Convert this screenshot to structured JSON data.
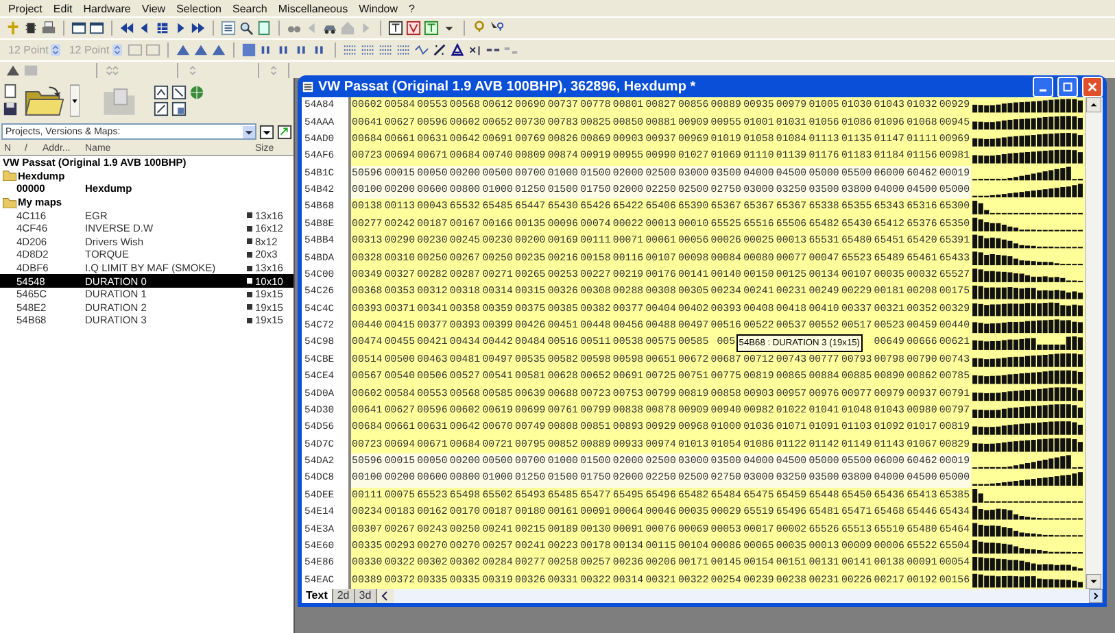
{
  "menu": [
    "Project",
    "Edit",
    "Hardware",
    "View",
    "Selection",
    "Search",
    "Miscellaneous",
    "Window",
    "?"
  ],
  "format_bar": {
    "font_sizes": [
      {
        "value": "12 Point",
        "disabled": true
      },
      {
        "value": "12 Point",
        "disabled": true
      }
    ]
  },
  "project_panel": {
    "selector": {
      "value": "Projects, Versions & Maps:"
    },
    "columns": [
      "N",
      "/",
      "Addr...",
      "Name",
      "Size"
    ],
    "tree": {
      "title": "VW Passat (Original 1.9 AVB 100BHP)",
      "children": [
        {
          "name": "Hexdump",
          "children": [
            {
              "address": "00000",
              "name": "Hexdump",
              "selected": false
            }
          ]
        },
        {
          "name": "My maps",
          "children": [
            {
              "address": "4C116",
              "name": "EGR",
              "size": "13x16",
              "selected": false
            },
            {
              "address": "4CF46",
              "name": "INVERSE D.W",
              "size": "16x12",
              "selected": false
            },
            {
              "address": "4D206",
              "name": "Drivers Wish",
              "size": "8x12",
              "selected": false
            },
            {
              "address": "4D8D2",
              "name": "TORQUE",
              "size": "20x3",
              "selected": false
            },
            {
              "address": "4DBF6",
              "name": "I.Q LIMIT BY MAF (SMOKE)",
              "size": "13x16",
              "selected": false
            },
            {
              "address": "54548",
              "name": "DURATION 0",
              "size": "10x10",
              "selected": true
            },
            {
              "address": "5465C",
              "name": "DURATION 1",
              "size": "19x15",
              "selected": false
            },
            {
              "address": "548E2",
              "name": "DURATION 2",
              "size": "19x15",
              "selected": false
            },
            {
              "address": "54B68",
              "name": "DURATION 3",
              "size": "19x15",
              "selected": false
            }
          ]
        }
      ]
    }
  },
  "window": {
    "title": "VW Passat (Original 1.9 AVB 100BHP), 362896, Hexdump *",
    "rows": [
      {
        "address": "54A84",
        "kind": "map",
        "cells": [
          "00602",
          "00584",
          "00553",
          "00568",
          "00612",
          "00690",
          "00737",
          "00778",
          "00801",
          "00827",
          "00856",
          "00889",
          "00935",
          "00979",
          "01005",
          "01030",
          "01043",
          "01032",
          "00929"
        ]
      },
      {
        "address": "54AAA",
        "kind": "map",
        "cells": [
          "00641",
          "00627",
          "00596",
          "00602",
          "00652",
          "00730",
          "00783",
          "00825",
          "00850",
          "00881",
          "00909",
          "00955",
          "01001",
          "01031",
          "01056",
          "01086",
          "01096",
          "01068",
          "00945"
        ]
      },
      {
        "address": "54AD0",
        "kind": "map",
        "cells": [
          "00684",
          "00661",
          "00631",
          "00642",
          "00691",
          "00769",
          "00826",
          "00869",
          "00903",
          "00937",
          "00969",
          "01019",
          "01058",
          "01084",
          "01113",
          "01135",
          "01147",
          "01111",
          "00969"
        ]
      },
      {
        "address": "54AF6",
        "kind": "map",
        "cells": [
          "00723",
          "00694",
          "00671",
          "00684",
          "00740",
          "00809",
          "00874",
          "00919",
          "00955",
          "00990",
          "01027",
          "01069",
          "01110",
          "01139",
          "01176",
          "01183",
          "01184",
          "01156",
          "00981"
        ]
      },
      {
        "address": "54B1C",
        "kind": "axis",
        "cells": [
          "50596",
          "00015",
          "00050",
          "00200",
          "00500",
          "00700",
          "01000",
          "01500",
          "02000",
          "02500",
          "03000",
          "03500",
          "04000",
          "04500",
          "05000",
          "05500",
          "06000",
          "60462",
          "00019"
        ]
      },
      {
        "address": "54B42",
        "kind": "axis",
        "cells": [
          "00100",
          "00200",
          "00600",
          "00800",
          "01000",
          "01250",
          "01500",
          "01750",
          "02000",
          "02250",
          "02500",
          "02750",
          "03000",
          "03250",
          "03500",
          "03800",
          "04000",
          "04500",
          "05000"
        ]
      },
      {
        "address": "54B68",
        "kind": "map",
        "cells": [
          "00138",
          "00113",
          "00043",
          "65532",
          "65485",
          "65447",
          "65430",
          "65426",
          "65422",
          "65406",
          "65390",
          "65367",
          "65367",
          "65367",
          "65338",
          "65355",
          "65343",
          "65316",
          "65300"
        ]
      },
      {
        "address": "54B8E",
        "kind": "map",
        "cells": [
          "00277",
          "00242",
          "00187",
          "00167",
          "00166",
          "00135",
          "00096",
          "00074",
          "00022",
          "00013",
          "00010",
          "65525",
          "65516",
          "65506",
          "65482",
          "65430",
          "65412",
          "65376",
          "65350"
        ]
      },
      {
        "address": "54BB4",
        "kind": "map",
        "cells": [
          "00313",
          "00290",
          "00230",
          "00245",
          "00230",
          "00200",
          "00169",
          "00111",
          "00071",
          "00061",
          "00056",
          "00026",
          "00025",
          "00013",
          "65531",
          "65480",
          "65451",
          "65420",
          "65391"
        ]
      },
      {
        "address": "54BDA",
        "kind": "map",
        "cells": [
          "00328",
          "00310",
          "00250",
          "00267",
          "00250",
          "00235",
          "00216",
          "00158",
          "00116",
          "00107",
          "00098",
          "00084",
          "00080",
          "00077",
          "00047",
          "65523",
          "65489",
          "65461",
          "65433"
        ]
      },
      {
        "address": "54C00",
        "kind": "map",
        "cells": [
          "00349",
          "00327",
          "00282",
          "00287",
          "00271",
          "00265",
          "00253",
          "00227",
          "00219",
          "00176",
          "00141",
          "00140",
          "00150",
          "00125",
          "00134",
          "00107",
          "00035",
          "00032",
          "65527"
        ]
      },
      {
        "address": "54C26",
        "kind": "map",
        "cells": [
          "00368",
          "00353",
          "00312",
          "00318",
          "00314",
          "00315",
          "00326",
          "00308",
          "00288",
          "00308",
          "00305",
          "00234",
          "00241",
          "00231",
          "00249",
          "00229",
          "00181",
          "00208",
          "00175"
        ]
      },
      {
        "address": "54C4C",
        "kind": "map",
        "cells": [
          "00393",
          "00371",
          "00341",
          "00358",
          "00359",
          "00375",
          "00385",
          "00382",
          "00377",
          "00404",
          "00402",
          "00393",
          "00408",
          "00418",
          "00410",
          "00337",
          "00321",
          "00352",
          "00329"
        ]
      },
      {
        "address": "54C72",
        "kind": "map",
        "cells": [
          "00440",
          "00415",
          "00377",
          "00393",
          "00399",
          "00426",
          "00451",
          "00448",
          "00456",
          "00488",
          "00497",
          "00516",
          "00522",
          "00537",
          "00552",
          "00517",
          "00523",
          "00459",
          "00440"
        ]
      },
      {
        "address": "54C98",
        "kind": "map",
        "tooltip": "54B68 : DURATION 3 (19x15)",
        "cells": [
          "00474",
          "00455",
          "00421",
          "00434",
          "00442",
          "00484",
          "00516",
          "00511",
          "00538",
          "00575",
          "00585",
          "005",
          null,
          null,
          null,
          null,
          "00649",
          "00666",
          "00621"
        ]
      },
      {
        "address": "54CBE",
        "kind": "map",
        "cells": [
          "00514",
          "00500",
          "00463",
          "00481",
          "00497",
          "00535",
          "00582",
          "00598",
          "00598",
          "00651",
          "00672",
          "00687",
          "00712",
          "00743",
          "00777",
          "00793",
          "00798",
          "00790",
          "00743"
        ]
      },
      {
        "address": "54CE4",
        "kind": "map",
        "cells": [
          "00567",
          "00540",
          "00506",
          "00527",
          "00541",
          "00581",
          "00628",
          "00652",
          "00691",
          "00725",
          "00751",
          "00775",
          "00819",
          "00865",
          "00884",
          "00885",
          "00890",
          "00862",
          "00785"
        ]
      },
      {
        "address": "54D0A",
        "kind": "map",
        "cells": [
          "00602",
          "00584",
          "00553",
          "00568",
          "00585",
          "00639",
          "00688",
          "00723",
          "00753",
          "00799",
          "00819",
          "00858",
          "00903",
          "00957",
          "00976",
          "00977",
          "00979",
          "00937",
          "00791"
        ]
      },
      {
        "address": "54D30",
        "kind": "map",
        "cells": [
          "00641",
          "00627",
          "00596",
          "00602",
          "00619",
          "00699",
          "00761",
          "00799",
          "00838",
          "00878",
          "00909",
          "00940",
          "00982",
          "01022",
          "01041",
          "01048",
          "01043",
          "00980",
          "00797"
        ]
      },
      {
        "address": "54D56",
        "kind": "map",
        "cells": [
          "00684",
          "00661",
          "00631",
          "00642",
          "00670",
          "00749",
          "00808",
          "00851",
          "00893",
          "00929",
          "00968",
          "01000",
          "01036",
          "01071",
          "01091",
          "01103",
          "01092",
          "01017",
          "00819"
        ]
      },
      {
        "address": "54D7C",
        "kind": "map",
        "cells": [
          "00723",
          "00694",
          "00671",
          "00684",
          "00721",
          "00795",
          "00852",
          "00889",
          "00933",
          "00974",
          "01013",
          "01054",
          "01086",
          "01122",
          "01142",
          "01149",
          "01143",
          "01067",
          "00829"
        ]
      },
      {
        "address": "54DA2",
        "kind": "axis",
        "cells": [
          "50596",
          "00015",
          "00050",
          "00200",
          "00500",
          "00700",
          "01000",
          "01500",
          "02000",
          "02500",
          "03000",
          "03500",
          "04000",
          "04500",
          "05000",
          "05500",
          "06000",
          "60462",
          "00019"
        ]
      },
      {
        "address": "54DC8",
        "kind": "axis",
        "cells": [
          "00100",
          "00200",
          "00600",
          "00800",
          "01000",
          "01250",
          "01500",
          "01750",
          "02000",
          "02250",
          "02500",
          "02750",
          "03000",
          "03250",
          "03500",
          "03800",
          "04000",
          "04500",
          "05000"
        ]
      },
      {
        "address": "54DEE",
        "kind": "map",
        "cells": [
          "00111",
          "00075",
          "65523",
          "65498",
          "65502",
          "65493",
          "65485",
          "65477",
          "65495",
          "65496",
          "65482",
          "65484",
          "65475",
          "65459",
          "65448",
          "65450",
          "65436",
          "65413",
          "65385"
        ]
      },
      {
        "address": "54E14",
        "kind": "map",
        "cells": [
          "00234",
          "00183",
          "00162",
          "00170",
          "00187",
          "00180",
          "00161",
          "00091",
          "00064",
          "00046",
          "00035",
          "00029",
          "65519",
          "65496",
          "65481",
          "65471",
          "65468",
          "65446",
          "65434"
        ]
      },
      {
        "address": "54E3A",
        "kind": "map",
        "cells": [
          "00307",
          "00267",
          "00243",
          "00250",
          "00241",
          "00215",
          "00189",
          "00130",
          "00091",
          "00076",
          "00069",
          "00053",
          "00017",
          "00002",
          "65526",
          "65513",
          "65510",
          "65480",
          "65464"
        ]
      },
      {
        "address": "54E60",
        "kind": "map",
        "cells": [
          "00335",
          "00293",
          "00270",
          "00270",
          "00257",
          "00241",
          "00223",
          "00178",
          "00134",
          "00115",
          "00104",
          "00086",
          "00065",
          "00035",
          "00013",
          "00009",
          "00006",
          "65522",
          "65504"
        ]
      },
      {
        "address": "54E86",
        "kind": "map",
        "cells": [
          "00330",
          "00322",
          "00302",
          "00302",
          "00284",
          "00277",
          "00258",
          "00257",
          "00236",
          "00206",
          "00171",
          "00145",
          "00154",
          "00151",
          "00131",
          "00141",
          "00138",
          "00091",
          "00054"
        ]
      },
      {
        "address": "54EAC",
        "kind": "map",
        "cells": [
          "00389",
          "00372",
          "00335",
          "00335",
          "00319",
          "00326",
          "00331",
          "00322",
          "00314",
          "00321",
          "00322",
          "00254",
          "00239",
          "00238",
          "00231",
          "00226",
          "00217",
          "00192",
          "00156"
        ]
      }
    ],
    "tabs": [
      {
        "label": "Text",
        "selected": true
      },
      {
        "label": "2d",
        "selected": false
      },
      {
        "label": "3d",
        "selected": false
      }
    ]
  }
}
